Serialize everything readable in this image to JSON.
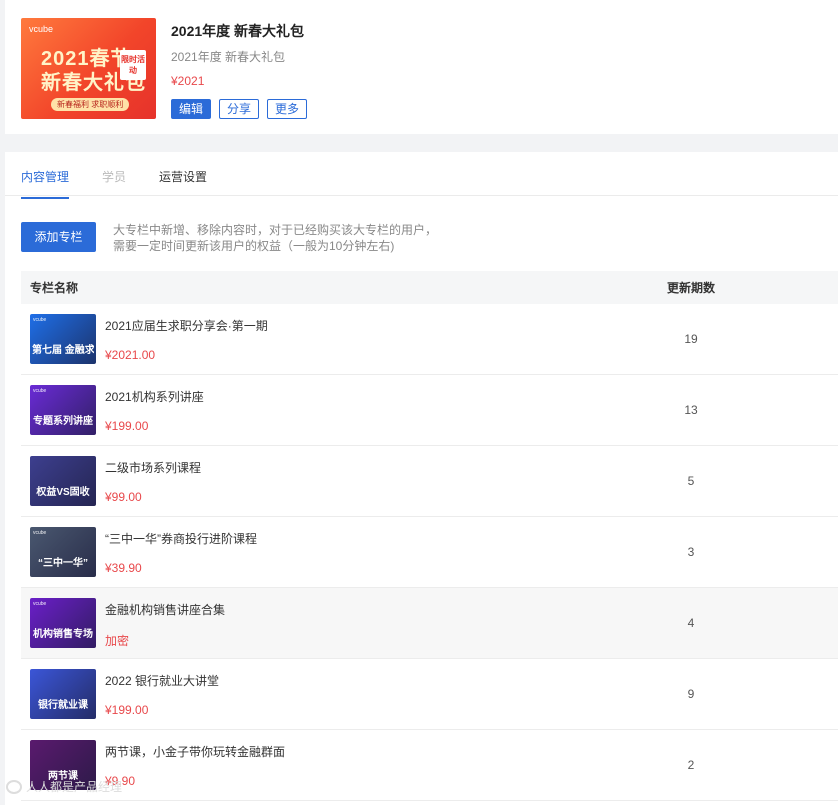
{
  "package": {
    "cover": {
      "brand": "vcube",
      "line1": "2021春节",
      "line2": "新春大礼包",
      "tag": "限时活动",
      "sub": "新春福利 求职顺利"
    },
    "title": "2021年度 新春大礼包",
    "subtitle": "2021年度 新春大礼包",
    "price": "¥2021",
    "actions": {
      "edit": "编辑",
      "share": "分享",
      "more": "更多"
    }
  },
  "tabs": [
    {
      "label": "内容管理",
      "state": "active"
    },
    {
      "label": "学员",
      "state": "disabled"
    },
    {
      "label": "运营设置",
      "state": "normal"
    }
  ],
  "toolbar": {
    "add_label": "添加专栏",
    "notice_line1": "大专栏中新增、移除内容时，对于已经购买该大专栏的用户，",
    "notice_line2": "需要一定时间更新该用户的权益（一般为10分钟左右)"
  },
  "table": {
    "headers": {
      "name": "专栏名称",
      "count": "更新期数"
    },
    "rows": [
      {
        "title": "2021应届生求职分享会·第一期",
        "price": "¥2021.00",
        "count": "19",
        "thumb": {
          "text": "第七届 金融求职分享会",
          "color": "#1f6fe8",
          "brand": "vcube"
        }
      },
      {
        "title": "2021机构系列讲座",
        "price": "¥199.00",
        "count": "13",
        "thumb": {
          "text": "专题系列讲座",
          "color": "#6a2bd6",
          "brand": "vcube"
        }
      },
      {
        "title": "二级市场系列课程",
        "price": "¥99.00",
        "count": "5",
        "thumb": {
          "text": "权益VS固收",
          "color": "#3d3f8f",
          "brand": ""
        }
      },
      {
        "title": "“三中一华”券商投行进阶课程",
        "price": "¥39.90",
        "count": "3",
        "thumb": {
          "text": "“三中一华”",
          "color": "#4a5870",
          "brand": "vcube"
        }
      },
      {
        "title": "金融机构销售讲座合集",
        "price": "加密",
        "count": "4",
        "thumb": {
          "text": "机构销售专场",
          "color": "#6b1fc9",
          "brand": "vcube"
        }
      },
      {
        "title": "2022 银行就业大讲堂",
        "price": "¥199.00",
        "count": "9",
        "thumb": {
          "text": "银行就业课",
          "color": "#3b56d8",
          "brand": ""
        }
      },
      {
        "title": "两节课，小金子带你玩转金融群面",
        "price": "¥9.90",
        "count": "2",
        "thumb": {
          "text": "两节课",
          "color": "#5a1a6e",
          "brand": ""
        }
      }
    ]
  },
  "watermark": "人人都是产品经理"
}
